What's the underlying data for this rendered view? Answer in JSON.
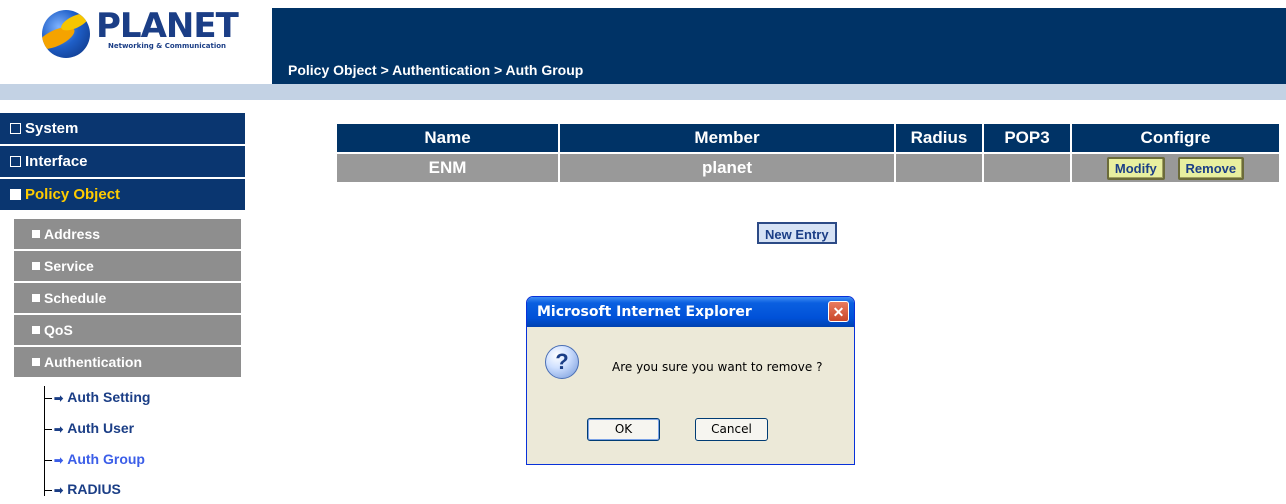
{
  "brand": {
    "name": "PLANET",
    "tagline": "Networking & Communication"
  },
  "header": {
    "breadcrumb": "Policy Object > Authentication > Auth Group"
  },
  "sidebar": {
    "top_items": [
      {
        "label": "System",
        "expanded": false
      },
      {
        "label": "Interface",
        "expanded": false
      },
      {
        "label": "Policy Object",
        "expanded": true,
        "active": true
      }
    ],
    "sub_items": [
      {
        "label": "Address"
      },
      {
        "label": "Service"
      },
      {
        "label": "Schedule"
      },
      {
        "label": "QoS"
      },
      {
        "label": "Authentication",
        "expanded": true
      }
    ],
    "leaf_items": [
      {
        "label": "Auth Setting"
      },
      {
        "label": "Auth User"
      },
      {
        "label": "Auth Group",
        "active": true
      },
      {
        "label": "RADIUS"
      }
    ]
  },
  "table": {
    "headers": [
      "Name",
      "Member",
      "Radius",
      "POP3",
      "Configre"
    ],
    "rows": [
      {
        "name": "ENM",
        "member": "planet",
        "radius": "",
        "pop3": ""
      }
    ],
    "modify_label": "Modify",
    "remove_label": "Remove"
  },
  "new_entry_label": "New Entry",
  "dialog": {
    "title": "Microsoft Internet Explorer",
    "message": "Are you sure you want to remove ?",
    "ok_label": "OK",
    "cancel_label": "Cancel"
  },
  "colors": {
    "header_navy": "#003366",
    "nav_navy": "#0a3670",
    "active_nav_text": "#ffcc00",
    "sub_nav_gray": "#8e8e8e",
    "table_row_gray": "#999999",
    "button_yellow": "#e8ef9f",
    "dialog_blue": "#0051d8"
  }
}
